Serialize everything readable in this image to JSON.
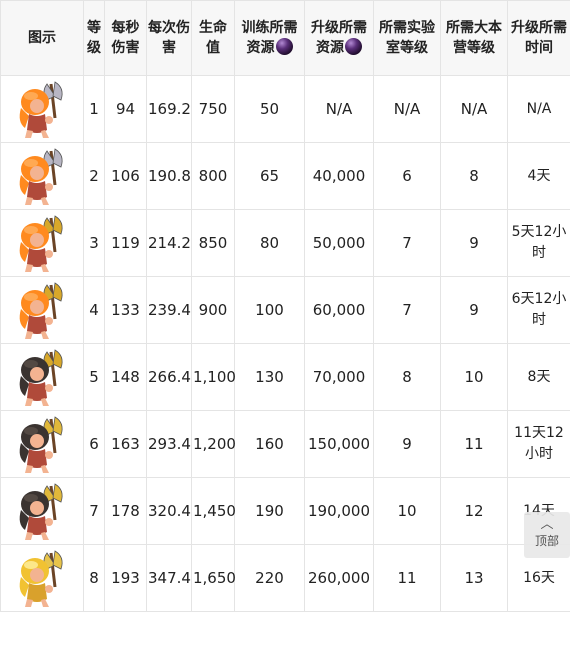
{
  "headers": {
    "image": "图示",
    "level": "等级",
    "dps": "每秒伤害",
    "dph": "每次伤害",
    "hp": "生命值",
    "train_cost": "训练所需资源",
    "upgrade_cost": "升级所需资源",
    "lab_level": "所需实验室等级",
    "th_level": "所需大本营等级",
    "upgrade_time": "升级所需时间"
  },
  "rows": [
    {
      "level": "1",
      "dps": "94",
      "dph": "169.2",
      "hp": "750",
      "train_cost": "50",
      "upgrade_cost": "N/A",
      "lab_level": "N/A",
      "th_level": "N/A",
      "upgrade_time": "N/A",
      "axe": "#b8b6c4",
      "helmet": "none"
    },
    {
      "level": "2",
      "dps": "106",
      "dph": "190.8",
      "hp": "800",
      "train_cost": "65",
      "upgrade_cost": "40,000",
      "lab_level": "6",
      "th_level": "8",
      "upgrade_time": "4天",
      "axe": "#b8b6c4",
      "helmet": "none"
    },
    {
      "level": "3",
      "dps": "119",
      "dph": "214.2",
      "hp": "850",
      "train_cost": "80",
      "upgrade_cost": "50,000",
      "lab_level": "7",
      "th_level": "9",
      "upgrade_time": "5天12小时",
      "axe": "#d8a82a",
      "helmet": "none"
    },
    {
      "level": "4",
      "dps": "133",
      "dph": "239.4",
      "hp": "900",
      "train_cost": "100",
      "upgrade_cost": "60,000",
      "lab_level": "7",
      "th_level": "9",
      "upgrade_time": "6天12小时",
      "axe": "#d8a82a",
      "helmet": "none"
    },
    {
      "level": "5",
      "dps": "148",
      "dph": "266.4",
      "hp": "1,100",
      "train_cost": "130",
      "upgrade_cost": "70,000",
      "lab_level": "8",
      "th_level": "10",
      "upgrade_time": "8天",
      "axe": "#d8a82a",
      "helmet": "dark"
    },
    {
      "level": "6",
      "dps": "163",
      "dph": "293.4",
      "hp": "1,200",
      "train_cost": "160",
      "upgrade_cost": "150,000",
      "lab_level": "9",
      "th_level": "11",
      "upgrade_time": "11天12小时",
      "axe": "#e0b83a",
      "helmet": "dark"
    },
    {
      "level": "7",
      "dps": "178",
      "dph": "320.4",
      "hp": "1,450",
      "train_cost": "190",
      "upgrade_cost": "190,000",
      "lab_level": "10",
      "th_level": "12",
      "upgrade_time": "14天",
      "axe": "#e0b83a",
      "helmet": "dark"
    },
    {
      "level": "8",
      "dps": "193",
      "dph": "347.4",
      "hp": "1,650",
      "train_cost": "220",
      "upgrade_cost": "260,000",
      "lab_level": "11",
      "th_level": "13",
      "upgrade_time": "16天",
      "axe": "#e8c44a",
      "helmet": "gold"
    }
  ],
  "back_to_top": {
    "label": "顶部",
    "icon": "chevron-up-icon"
  },
  "colors": {
    "header_bg": "#f7f7f7",
    "border": "#e4e4e4",
    "elixir": "#5a2f7a"
  }
}
